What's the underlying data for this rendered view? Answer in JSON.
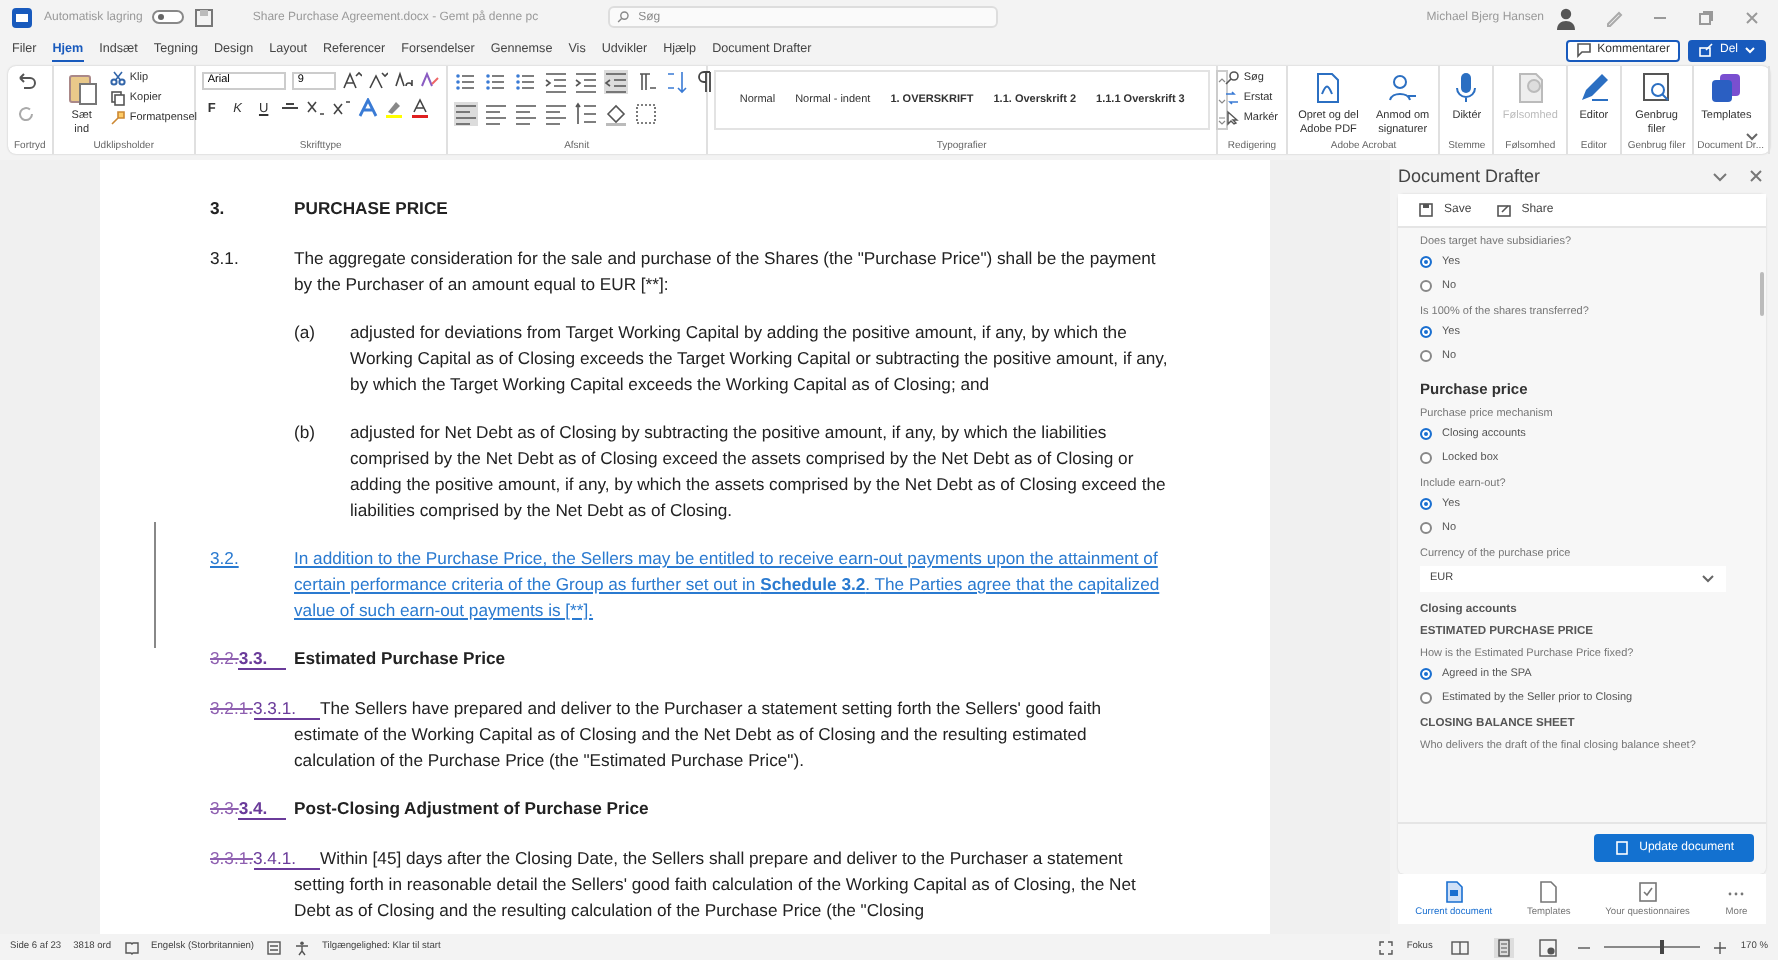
{
  "title_bar": {
    "autosave_label": "Automatisk lagring",
    "autosave_on": false,
    "document_title": "Share Purchase Agreement.docx - Gemt på denne pc",
    "search_placeholder": "Søg",
    "user_name": "Michael Bjerg Hansen"
  },
  "menu": {
    "tabs": [
      {
        "label": "Filer",
        "selected": false
      },
      {
        "label": "Hjem",
        "selected": true
      },
      {
        "label": "Indsæt",
        "selected": false
      },
      {
        "label": "Tegning",
        "selected": false
      },
      {
        "label": "Design",
        "selected": false
      },
      {
        "label": "Layout",
        "selected": false
      },
      {
        "label": "Referencer",
        "selected": false
      },
      {
        "label": "Forsendelser",
        "selected": false
      },
      {
        "label": "Gennemse",
        "selected": false
      },
      {
        "label": "Vis",
        "selected": false
      },
      {
        "label": "Udvikler",
        "selected": false
      },
      {
        "label": "Hjælp",
        "selected": false
      },
      {
        "label": "Document Drafter",
        "selected": false
      }
    ],
    "comments_button": "Kommentarer",
    "share_button": "Del"
  },
  "ribbon": {
    "groups": [
      {
        "kind": "undo",
        "label": "Fortryd"
      },
      {
        "kind": "clipboard",
        "label": "Udklipsholder",
        "paste": "Sæt ind",
        "items": [
          "Klip",
          "Kopier",
          "Formatpensel"
        ]
      },
      {
        "kind": "font",
        "label": "Skrifttype",
        "font": "Arial",
        "size": "9",
        "format_buttons": [
          "F",
          "K",
          "U"
        ]
      },
      {
        "kind": "paragraph",
        "label": "Afsnit"
      },
      {
        "kind": "styles",
        "label": "Typografier",
        "styles": [
          "Normal",
          "Normal - indent",
          "1. OVERSKRIFT",
          "1.1.  Overskrift 2",
          "1.1.1  Overskrift 3"
        ]
      },
      {
        "kind": "editing",
        "label": "Redigering",
        "items": [
          "Søg",
          "Erstat",
          "Markér"
        ]
      },
      {
        "kind": "large",
        "label": "Adobe Acrobat",
        "buttons": [
          {
            "label": "Opret og del Adobe PDF",
            "kind": "pdf",
            "disabled": false
          },
          {
            "label": "Anmod om signaturer",
            "kind": "signature",
            "disabled": false
          }
        ]
      },
      {
        "kind": "large",
        "label": "Stemme",
        "buttons": [
          {
            "label": "Diktér",
            "kind": "mic",
            "disabled": false
          }
        ]
      },
      {
        "kind": "large",
        "label": "Følsomhed",
        "buttons": [
          {
            "label": "Følsomhed",
            "kind": "sensitivity",
            "disabled": true
          }
        ]
      },
      {
        "kind": "large",
        "label": "Editor",
        "buttons": [
          {
            "label": "Editor",
            "kind": "pen",
            "disabled": false
          }
        ]
      },
      {
        "kind": "large",
        "label": "Genbrug filer",
        "buttons": [
          {
            "label": "Genbrug filer",
            "kind": "reuse",
            "disabled": false
          }
        ]
      },
      {
        "kind": "large",
        "label": "Document Dr...",
        "buttons": [
          {
            "label": "Templates",
            "kind": "templates",
            "disabled": false
          }
        ]
      }
    ]
  },
  "document": {
    "blocks": [
      {
        "kind": "heading",
        "number": "3.",
        "text": "PURCHASE PRICE"
      },
      {
        "kind": "clause",
        "number": "3.1.",
        "text": "The aggregate consideration for the sale and purchase of the Shares (the \"Purchase Price\") shall be the payment by the Purchaser of an amount equal to EUR [**]:"
      },
      {
        "kind": "item",
        "number": "(a)",
        "text": "adjusted for deviations from Target Working Capital by adding the positive amount, if any, by which the Working Capital as of Closing exceeds the Target Working Capital or subtracting the positive amount, if any, by which the Target Working Capital exceeds the Working Capital as of Closing; and"
      },
      {
        "kind": "item",
        "number": "(b)",
        "text": "adjusted for Net Debt as of Closing by subtracting the positive amount, if any, by which the liabilities comprised by the Net Debt as of Closing exceed the assets comprised by the Net Debt as of Closing or adding the positive amount, if any, by which the assets comprised by the Net Debt as of Closing exceed the liabilities comprised by the Net Debt as of Closing."
      },
      {
        "kind": "clause",
        "number": "3.2.",
        "inserted": true,
        "text": "In addition to the Purchase Price, the Sellers may be entitled to receive earn-out payments upon the attainment of certain performance criteria of the Group as further set out in **Schedule 3.2**. The Parties agree that the capitalized value of such earn-out payments is [**]."
      },
      {
        "kind": "subheading",
        "deleted_number": "3.2.",
        "number": "3.3.",
        "text": "Estimated Purchase Price"
      },
      {
        "kind": "clause",
        "deleted_number": "3.2.1.",
        "number": "3.3.1.",
        "text": "The Sellers have prepared and deliver to the Purchaser a statement setting forth the Sellers' good faith estimate of the Working Capital as of Closing and the Net Debt as of Closing and the resulting estimated calculation of the Purchase Price (the \"Estimated Purchase Price\")."
      },
      {
        "kind": "subheading",
        "deleted_number": "3.3.",
        "number": "3.4.",
        "text": "Post-Closing Adjustment of Purchase Price"
      },
      {
        "kind": "clause",
        "deleted_number": "3.3.1.",
        "number": "3.4.1.",
        "text": "Within [45] days after the Closing Date, the Sellers shall prepare and deliver to the Purchaser a statement setting forth in reasonable detail the Sellers' good faith calculation of the Working Capital as of Closing, the Net Debt as of Closing and the resulting calculation of the Purchase Price (the \"Closing"
      }
    ]
  },
  "panel": {
    "title": "Document Drafter",
    "toolbar": [
      "Save",
      "Share"
    ],
    "form": [
      {
        "kind": "question",
        "label": "Does target have subsidiaries?",
        "options": [
          {
            "label": "Yes",
            "selected": true
          },
          {
            "label": "No",
            "selected": false
          }
        ]
      },
      {
        "kind": "question",
        "label": "Is 100% of the shares transferred?",
        "options": [
          {
            "label": "Yes",
            "selected": true
          },
          {
            "label": "No",
            "selected": false
          }
        ]
      },
      {
        "kind": "section",
        "label": "Purchase price"
      },
      {
        "kind": "question",
        "label": "Purchase price mechanism",
        "options": [
          {
            "label": "Closing accounts",
            "selected": true
          },
          {
            "label": "Locked box",
            "selected": false
          }
        ]
      },
      {
        "kind": "question",
        "label": "Include earn-out?",
        "options": [
          {
            "label": "Yes",
            "selected": true
          },
          {
            "label": "No",
            "selected": false
          }
        ]
      },
      {
        "kind": "select",
        "label": "Currency of the purchase price",
        "value": "EUR"
      },
      {
        "kind": "subsection",
        "label": "Closing accounts"
      },
      {
        "kind": "caps",
        "label": "ESTIMATED PURCHASE PRICE"
      },
      {
        "kind": "question",
        "label": "How is the Estimated Purchase Price fixed?",
        "options": [
          {
            "label": "Agreed in the SPA",
            "selected": true
          },
          {
            "label": "Estimated by the Seller prior to Closing",
            "selected": false
          }
        ]
      },
      {
        "kind": "caps",
        "label": "CLOSING BALANCE SHEET"
      },
      {
        "kind": "question",
        "label": "Who delivers the draft of the final closing balance sheet?"
      }
    ],
    "update_button": "Update document",
    "nav": [
      {
        "label": "Current document",
        "kind": "doc",
        "selected": true
      },
      {
        "label": "Templates",
        "kind": "page",
        "selected": false
      },
      {
        "label": "Your questionnaires",
        "kind": "check",
        "selected": false
      },
      {
        "label": "More",
        "kind": "more",
        "selected": false
      }
    ]
  },
  "status_bar": {
    "page": "Side 6 af 23",
    "words": "3818 ord",
    "language": "Engelsk (Storbritannien)",
    "accessibility": "Tilgængelighed: Klar til start",
    "focus": "Fokus",
    "zoom": {
      "level": 0.6,
      "reading": "170 %"
    }
  }
}
